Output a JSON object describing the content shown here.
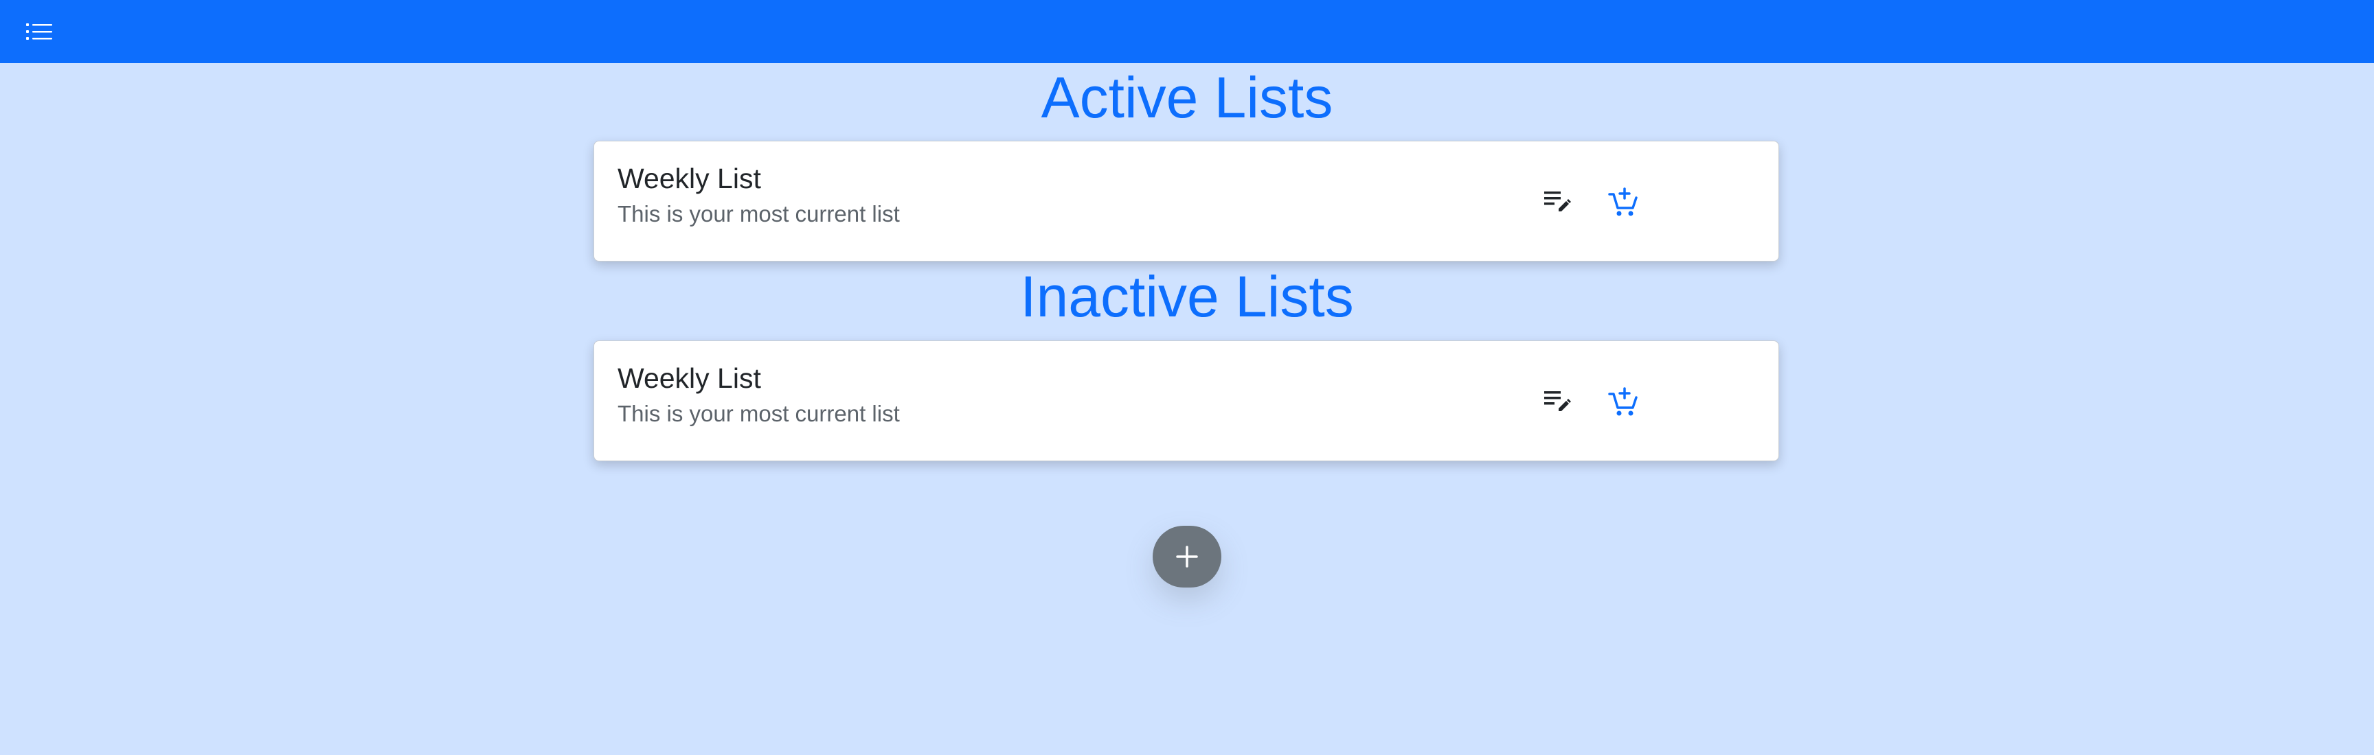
{
  "navbar": {
    "menu_icon": "list-icon",
    "color": "#0d6efd"
  },
  "active_section": {
    "title": "Active Lists",
    "lists": [
      {
        "name": "Weekly List",
        "description": "This is your most current list",
        "edit_icon": "playlist-edit-icon",
        "shop_icon": "add-shopping-cart-icon"
      }
    ]
  },
  "inactive_section": {
    "title": "Inactive Lists",
    "lists": [
      {
        "name": "Weekly List",
        "description": "This is your most current list",
        "edit_icon": "playlist-edit-icon",
        "shop_icon": "add-shopping-cart-icon"
      }
    ]
  },
  "fab": {
    "icon": "plus-icon"
  },
  "colors": {
    "background": "#cfe2ff",
    "accent": "#0d6efd",
    "fab": "#6c757d"
  }
}
